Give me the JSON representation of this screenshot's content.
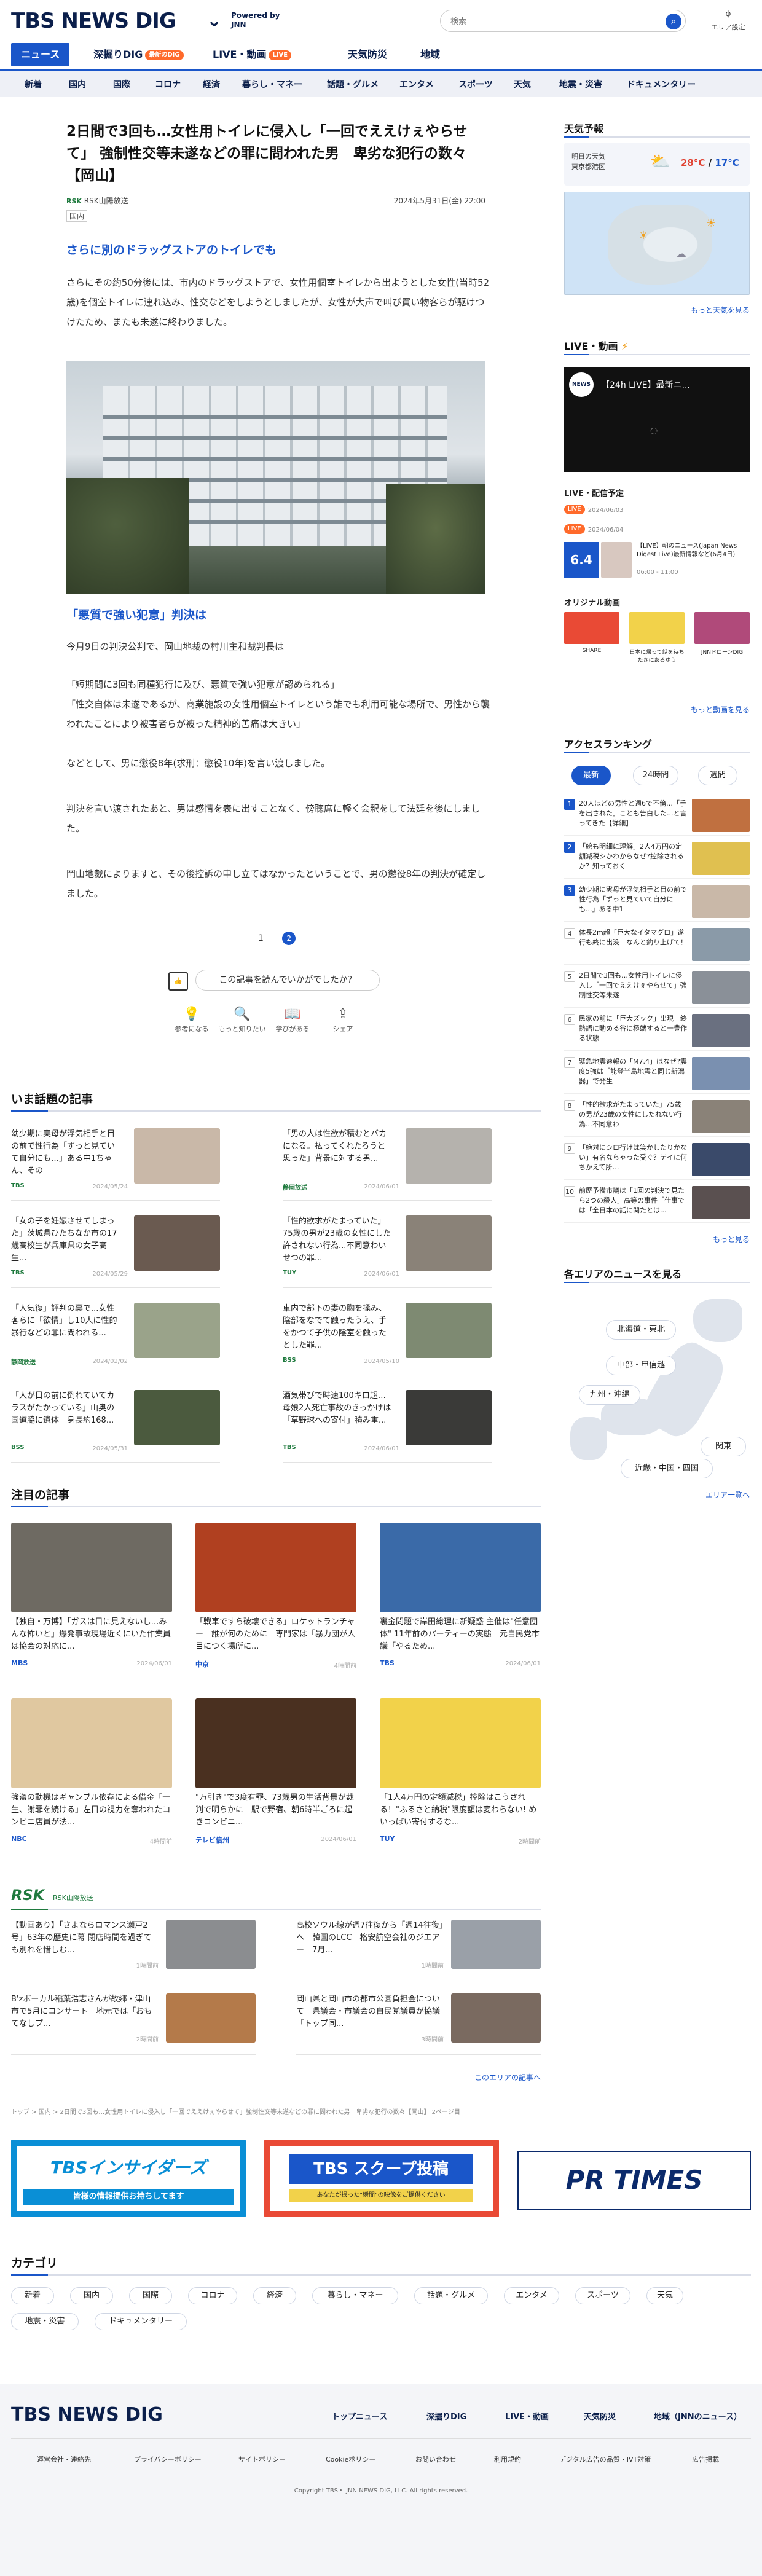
{
  "header": {
    "logo": "TBS NEWS DIG",
    "powered": "Powered by JNN",
    "search_placeholder": "検索",
    "area_label": "エリア設定"
  },
  "main_nav": [
    {
      "label": "ニュース"
    },
    {
      "label": "深掘りDIG",
      "tag": "最新のDIG"
    },
    {
      "label": "LIVE・動画",
      "tag": "LIVE"
    },
    {
      "label": "天気防災"
    },
    {
      "label": "地域"
    }
  ],
  "sub_nav": [
    "新着",
    "国内",
    "国際",
    "コロナ",
    "経済",
    "暮らし・マネー",
    "話題・グルメ",
    "エンタメ",
    "スポーツ",
    "天気",
    "地震・災害",
    "ドキュメンタリー"
  ],
  "article": {
    "title": "2日間で3回も…女性用トイレに侵入し「一回でええけぇやらせて」 強制性交等未遂などの罪に問われた男　卑劣な犯行の数々【岡山】",
    "source": "RSK山陽放送",
    "category": "国内",
    "date": "2024年5月31日(金) 22:00",
    "lead_heading": "さらに別のドラッグストアのトイレでも",
    "para1": "さらにその約50分後には、市内のドラッグストアで、女性用個室トイレから出ようとした女性(当時52歳)を個室トイレに連れ込み、性交などをしようとしましたが、女性が大声で叫び買い物客らが駆けつけたため、またも未遂に終わりました。",
    "sub_heading": "「悪質で強い犯意」判決は",
    "para2": "今月9日の判決公判で、岡山地裁の村川主和裁判長は",
    "para3": "「短期間に3回も同種犯行に及び、悪質で強い犯意が認められる」\n「性交自体は未遂であるが、商業施設の女性用個室トイレという誰でも利用可能な場所で、男性から襲われたことにより被害者らが被った精神的苦痛は大きい」",
    "para4": "などとして、男に懲役8年(求刑：懲役10年)を言い渡しました。",
    "para5": "判決を言い渡されたあと、男は感情を表に出すことなく、傍聴席に軽く会釈をして法廷を後にしました。",
    "para6": "岡山地裁によりますと、その後控訴の申し立てはなかったということで、男の懲役8年の判決が確定しました。",
    "pager_prev": "1",
    "pager_cur": "2",
    "feedback_q": "この記事を読んでいかがでしたか？",
    "reactions": [
      "参考になる",
      "もっと知りたい",
      "学びがある",
      "シェア"
    ]
  },
  "trending": {
    "heading": "いま話題の記事",
    "items": [
      {
        "title": "幼少期に実母が浮気相手と目の前で性行為「ずっと見ていて自分にも…」ある中1ちゃん、その",
        "src": "TBS",
        "date": "2024/05/24",
        "color": "#c9b8a8"
      },
      {
        "title": "「男の人は性欲が積むとバカになる。払ってくれたろうと思った」背景に対する男...",
        "src": "静岡放送",
        "date": "2024/06/01",
        "color": "#b5b2ad"
      },
      {
        "title": "「女の子を妊娠させてしまった」茨城県ひたちなか市の17歳高校生が兵庫県の女子高生...",
        "src": "TBS",
        "date": "2024/05/29",
        "color": "#6a5a50"
      },
      {
        "title": "「性的欲求がたまっていた」75歳の男が23歳の女性にした許されない行為...不同意わいせつの罪...",
        "src": "TUY",
        "date": "2024/06/01",
        "color": "#8a8278"
      },
      {
        "title": "「人気復」評判の裏で...女性客らに「欲情」し10人に性的暴行などの罪に問われる...",
        "src": "静岡放送",
        "date": "2024/02/02",
        "color": "#9aa38a"
      },
      {
        "title": "車内で部下の妻の胸を揉み、陰部をなでて触ったうえ、手をかつて子供の陰室を触ったとした罪...",
        "src": "BSS",
        "date": "2024/05/10",
        "color": "#7e8a72"
      },
      {
        "title": "「人が目の前に倒れていてカラスがたかっている」山奥の国道脇に遺体　身長約168...",
        "src": "BSS",
        "date": "2024/05/31",
        "color": "#4b5a3e"
      },
      {
        "title": "酒気帯びで時速100キロ超…母娘2人死亡事故のきっかけは「草野球への寄付」積み重...",
        "src": "TBS",
        "date": "2024/06/01",
        "color": "#3a3a38"
      }
    ]
  },
  "featured": {
    "heading": "注目の記事",
    "items": [
      {
        "title": "【独自・万博】「ガスは目に見えないし…みんな怖いと」爆発事故現場近くにいた作業員は協会の対応に...",
        "src": "MBS",
        "date": "2024/06/01",
        "color": "#6e6a62"
      },
      {
        "title": "「戦車ですら破壊できる」ロケットランチャー　誰が何のために　専門家は「暴力団が人目につく場所に...",
        "src": "中京",
        "date": "4時間前",
        "color": "#b04020"
      },
      {
        "title": "裏金問題で岸田総理に新疑惑 主催は\"任意団体\" 11年前のパーティーの実態　元自民党市議「やるため...",
        "src": "TBS",
        "date": "2024/06/01",
        "color": "#3a6aa8"
      },
      {
        "title": "強盗の動機はギャンブル依存による借金「一生、謝罪を続ける」左目の視力を奪われたコンビニ店員が法...",
        "src": "NBC",
        "date": "4時間前",
        "color": "#e0c8a0"
      },
      {
        "title": "\"万引き\"で3度有罪、73歳男の生活背景が裁判で明らかに　駅で野宿、朝6時半ごろに起きコンビニ...",
        "src": "テレビ信州",
        "date": "2024/06/01",
        "color": "#4a3020"
      },
      {
        "title": "「1人4万円の定額減税」控除はこうされる！\"ふるさと納税\"限度額は変わらない! めいっぱい寄付するな...",
        "src": "TUY",
        "date": "2時間前",
        "color": "#f2d24a"
      }
    ]
  },
  "rsk": {
    "label": "RSK山陽放送",
    "items": [
      {
        "title": "【動画あり】「さよならロマンス瀬戸2号」63年の歴史に幕 閉店時間を過ぎても別れを惜しむ...",
        "date": "1時間前",
        "color": "#8b8d90"
      },
      {
        "title": "高校ソウル線が週7往復から「週14往復」へ　韓国のLCC＝格安航空会社のジエアー　7月...",
        "date": "1時間前",
        "color": "#9aa0a8"
      },
      {
        "title": "B'zボーカル稲葉浩志さんが故郷・津山市で5月にコンサート　地元では「おもてなしプ...",
        "date": "2時間前",
        "color": "#b47a4a"
      },
      {
        "title": "岡山県と岡山市の都市公園負担金について　県議会・市議会の自民党議員が協議「トップ同...",
        "date": "3時間前",
        "color": "#7a6a60"
      }
    ],
    "more": "このエリアの記事へ"
  },
  "breadcrumb": "トップ > 国内 > 2日間で3回も…女性用トイレに侵入し「一回でええけぇやらせて」強制性交等未遂などの罪に問われた男　卑劣な犯行の数々【岡山】 2ページ目",
  "banners": [
    "TBSインサイダーズ",
    "TBS スクープ投稿",
    "PR TIMES"
  ],
  "banner_subs": [
    "皆様の情報提供お持ちしてます",
    "あなたが撮った\"瞬間\"の映像をご提供ください"
  ],
  "categories": {
    "heading": "カテゴリ",
    "items": [
      "新着",
      "国内",
      "国際",
      "コロナ",
      "経済",
      "暮らし・マネー",
      "話題・グルメ",
      "エンタメ",
      "スポーツ",
      "天気",
      "地震・災害",
      "ドキュメンタリー"
    ]
  },
  "sidebar": {
    "weather_heading": "天気予報",
    "weather_place": "明日の天気\n東京都港区",
    "temp_hi": "28°C",
    "temp_lo": "17°C",
    "weather_more": "もっと天気を見る",
    "live_heading": "LIVE・動画",
    "live_title": "【24h LIVE】最新ニ...",
    "live_sched_heading": "LIVE・配信予定",
    "live_sched": [
      {
        "tag": "LIVE",
        "date": "2024/06/03"
      },
      {
        "tag": "LIVE",
        "date": "2024/06/04"
      }
    ],
    "live_item_title": "【LIVE】朝のニュース(Japan News Digest Live)最新情報など(6月4日)",
    "live_item_time": "06:00 - 11:00",
    "live_item_date": "6.4",
    "original_heading": "オリジナル動画",
    "original_items": [
      "SHARE",
      "日本に帰って話を待ちたきにあるゆう",
      "JNNドローンDIG"
    ],
    "video_more": "もっと動画を見る",
    "ranking_heading": "アクセスランキング",
    "ranking_tabs": [
      "最新",
      "24時間",
      "週間"
    ],
    "ranking": [
      {
        "t": "20人ほどの男性と週6で不倫…「手を出された」ことも告白した...と言ってきた【詳細】",
        "c": "#c07040"
      },
      {
        "t": "「絵も明細に理解」2人4万円の定額減税シかわからなぜ?控除されるか？知っておく",
        "c": "#e0c050"
      },
      {
        "t": "幼少期に実母が浮気相手と目の前で性行為「ずっと見ていて自分にも...」ある中1",
        "c": "#c9b8a8"
      },
      {
        "t": "体長2m超「巨大なイタマグロ」遂行も終に出没　なんと釣り上げて！",
        "c": "#8a9aa8"
      },
      {
        "t": "2日間で3回も…女性用トイレに侵入し「一回でええけぇやらせて」強制性交等未遂",
        "c": "#8a9098"
      },
      {
        "t": "民家の前に「巨大ズック」出現　終熱語に動める谷に極端すると一豊作る状態",
        "c": "#6a7080"
      },
      {
        "t": "緊急地震速報の「M7.4」はなぜ?震度5強は「能登半島地震と同じ新潟器」で発生",
        "c": "#7a90b0"
      },
      {
        "t": "「性的欲求がたまっていた」75歳の男が23歳の女性にしたれない行為...不同意わ",
        "c": "#8a8278"
      },
      {
        "t": "「絶対にシロ行けは笑かしたりかない」有名ならゃった受ぐ？テイに何ちかえて所…",
        "c": "#3a4a6a"
      },
      {
        "t": "前歴予備市議は「1回の判決で見たら2つの殺人」高等の事件「仕事では「全日本の話に関たとは...",
        "c": "#5a5050"
      }
    ],
    "ranking_more": "もっと見る",
    "area_heading": "各エリアのニュースを見る",
    "areas": [
      "北海道・東北",
      "中部・甲信越",
      "九州・沖縄",
      "関東",
      "近畿・中国・四国"
    ],
    "area_more": "エリア一覧へ"
  },
  "footer": {
    "logo": "TBS NEWS DIG",
    "nav": [
      "トップニュース",
      "深掘りDIG",
      "LIVE・動画",
      "天気防災",
      "地域（JNNのニュース）"
    ],
    "links": [
      "運営会社・連絡先",
      "プライバシーポリシー",
      "サイトポリシー",
      "Cookieポリシー",
      "お問い合わせ",
      "利用規約",
      "デジタル広告の品質・IVT対策",
      "広告掲載"
    ],
    "copyright": "Copyright TBS・ JNN NEWS DIG, LLC. All rights reserved."
  },
  "colors": {
    "brand": "#0b1f4b",
    "accent": "#1a56c9",
    "tag": "#ff6a2b",
    "rsk": "#1f7a3e"
  }
}
